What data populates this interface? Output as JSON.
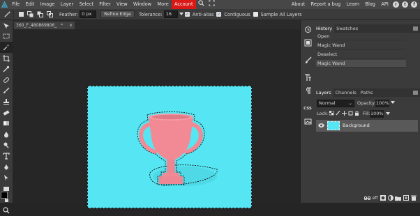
{
  "menu": {
    "items": [
      "File",
      "Edit",
      "Image",
      "Layer",
      "Select",
      "Filter",
      "View",
      "Window",
      "More"
    ],
    "account": "Account",
    "right": [
      "About",
      "Report a bug",
      "Learn",
      "Blog",
      "API"
    ]
  },
  "options": {
    "feather_label": "Feather:",
    "feather_value": "0 px",
    "refine_edge": "Refine Edge",
    "tolerance_label": "Tolerance:",
    "tolerance_value": "16",
    "anti_alias": "Anti-alias",
    "contiguous": "Contiguous",
    "sample_all": "Sample All Layers"
  },
  "document": {
    "tab_name": "360_F_480869806_",
    "tab_modified": "*",
    "canvas_color": "#56e6f3",
    "trophy_color": "#f28a96"
  },
  "history": {
    "tabs": [
      "History",
      "Swatches"
    ],
    "items": [
      "Open",
      "Magic Wand",
      "Deselect",
      "Magic Wand"
    ],
    "selected_index": 3
  },
  "layers": {
    "tabs": [
      "Layers",
      "Channels",
      "Paths"
    ],
    "blend_mode": "Normal",
    "opacity_label": "Opacity:",
    "opacity_value": "100%",
    "lock_label": "Lock:",
    "fill_label": "Fill:",
    "fill_value": "100%",
    "layer_name": "Background"
  },
  "icons": [
    "magic-wand-icon",
    "move-icon",
    "marquee-icon",
    "lasso-icon",
    "crop-icon",
    "eyedropper-icon",
    "heal-icon",
    "brush-icon",
    "stamp-icon",
    "eraser-icon",
    "bucket-icon",
    "blur-icon",
    "dodge-icon",
    "pen-icon",
    "text-icon",
    "path-select-icon",
    "shape-icon",
    "hand-icon",
    "zoom-icon"
  ]
}
